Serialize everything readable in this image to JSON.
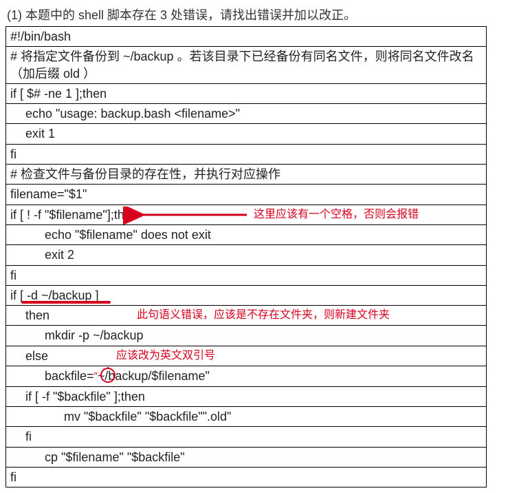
{
  "question": "(1) 本题中的 shell 脚本存在 3 处错误，请找出错误并加以改正。",
  "lines": {
    "l0": "#!/bin/bash",
    "l1": "# 将指定文件备份到 ~/backup 。若该目录下已经备份有同名文件，则将同名文件改名（加后缀 old ）",
    "l2": "if [ $# -ne 1 ];then",
    "l3": "echo \"usage: backup.bash <filename>\"",
    "l4": "exit 1",
    "l5": "fi",
    "l6": "# 检查文件与备份目录的存在性，并执行对应操作",
    "l7": "filename=\"$1\"",
    "l8": "if [ ! -f \"$filename\"];then",
    "l9": "echo \"$filename\" does not exit",
    "l10": "exit 2",
    "l11": "fi",
    "l12": "if [ -d ~/backup ]",
    "l13": "then",
    "l14": "mkdir -p ~/backup",
    "l15": "else",
    "l16a": "backfile=",
    "l16b": "~/backup/$filename\"",
    "l17": "if [ -f \"$backfile\" ];then",
    "l18": "mv \"$backfile\" \"$backfile\"\".old\"",
    "l19": "fi",
    "l20": "cp \"$filename\" \"$backfile\"",
    "l21": "fi"
  },
  "annotations": {
    "a1": "这里应该有一个空格，否则会报错",
    "a2": "此句语义错误，应该是不存在文件夹，则新建文件夹",
    "a3": "应该改为英文双引号"
  },
  "quote_char": "”"
}
